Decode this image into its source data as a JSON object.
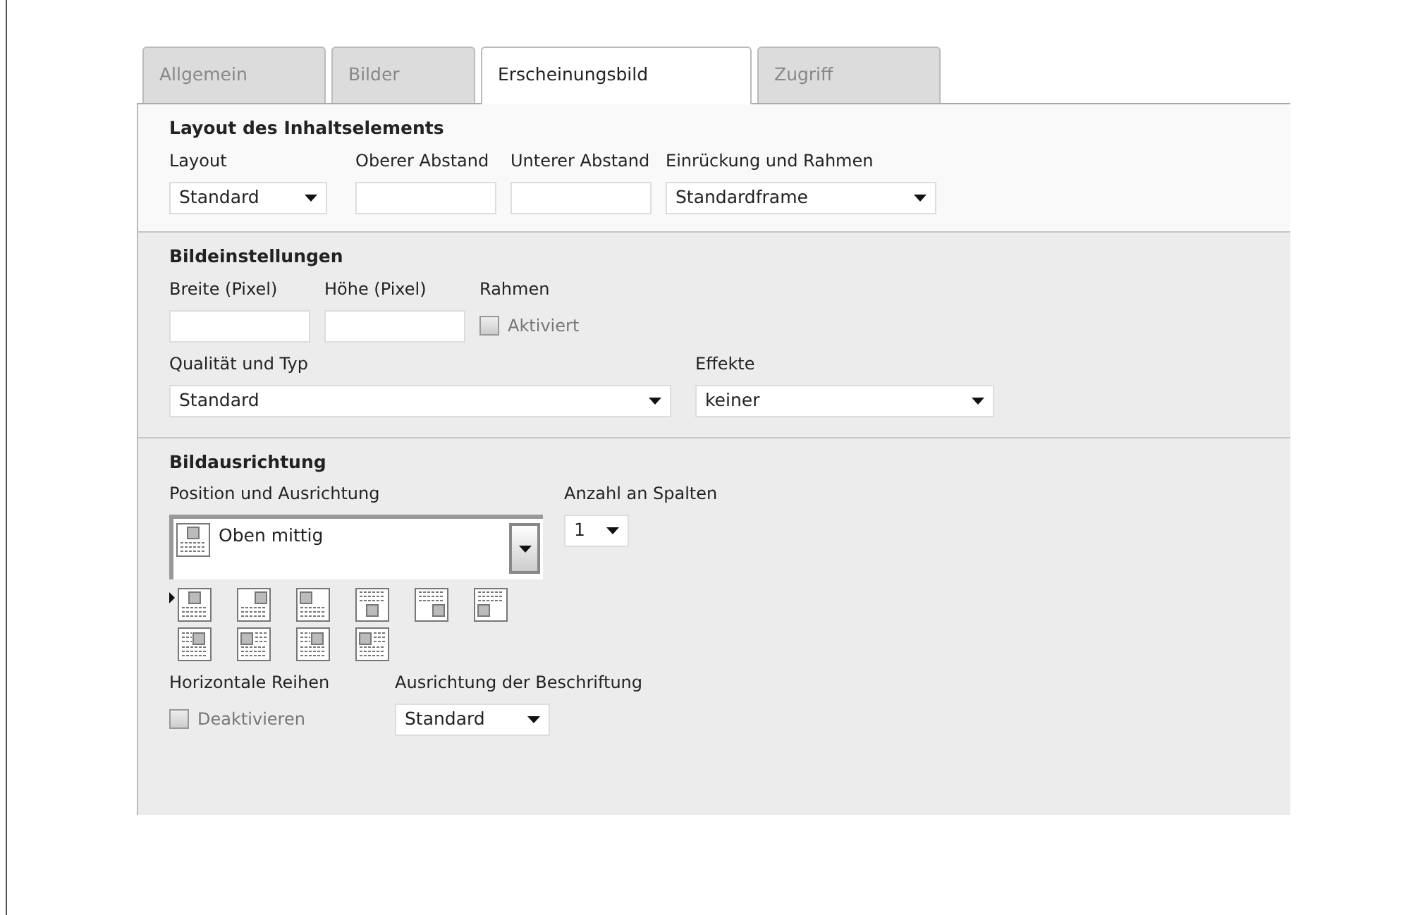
{
  "tabs": [
    {
      "label": "Allgemein",
      "selected": false
    },
    {
      "label": "Bilder",
      "selected": false
    },
    {
      "label": "Erscheinungsbild",
      "selected": true
    },
    {
      "label": "Zugriff",
      "selected": false
    }
  ],
  "sections": [
    {
      "title": "Layout des Inhaltselements",
      "rows": [
        [
          {
            "kind": "select",
            "label": "Layout",
            "value": "Standard"
          },
          {
            "kind": "text",
            "label": "Oberer Abstand"
          },
          {
            "kind": "text",
            "label": "Unterer Abstand"
          },
          {
            "kind": "select",
            "label": "Einrückung und Rahmen",
            "value": "Standardframe"
          }
        ]
      ]
    },
    {
      "title": "Bildeinstellungen",
      "rows": [
        [
          {
            "kind": "text",
            "label": "Breite (Pixel)"
          },
          {
            "kind": "text",
            "label": "Höhe (Pixel)"
          },
          {
            "kind": "checkbox",
            "label": "Rahmen",
            "option": "Aktiviert",
            "checked": false
          }
        ],
        [
          {
            "kind": "select",
            "label": "Qualität und Typ",
            "value": "Standard"
          },
          {
            "kind": "select",
            "label": "Effekte",
            "value": "keiner"
          }
        ]
      ]
    },
    {
      "title": "Bildausrichtung",
      "rows": [
        [
          {
            "kind": "iconselect",
            "label": "Position und Ausrichtung",
            "value": "Oben mittig"
          },
          {
            "kind": "select",
            "label": "Anzahl an Spalten",
            "value": "1"
          }
        ],
        [
          {
            "kind": "tiles",
            "tiles": [
              {
                "kind": "above-center",
                "selected": true
              },
              {
                "kind": "above-right",
                "selected": false
              },
              {
                "kind": "above-left",
                "selected": false
              },
              {
                "kind": "below-center",
                "selected": false
              },
              {
                "kind": "below-right",
                "selected": false
              },
              {
                "kind": "below-left",
                "selected": false
              },
              {
                "kind": "intext-right",
                "selected": false
              },
              {
                "kind": "intext-left",
                "selected": false
              },
              {
                "kind": "beside-right",
                "selected": false
              },
              {
                "kind": "beside-left",
                "selected": false
              }
            ]
          }
        ],
        [
          {
            "kind": "checkbox",
            "label": "Horizontale Reihen",
            "option": "Deaktivieren",
            "checked": false
          },
          {
            "kind": "select",
            "label": "Ausrichtung der Beschriftung",
            "value": "Standard"
          }
        ]
      ]
    }
  ]
}
